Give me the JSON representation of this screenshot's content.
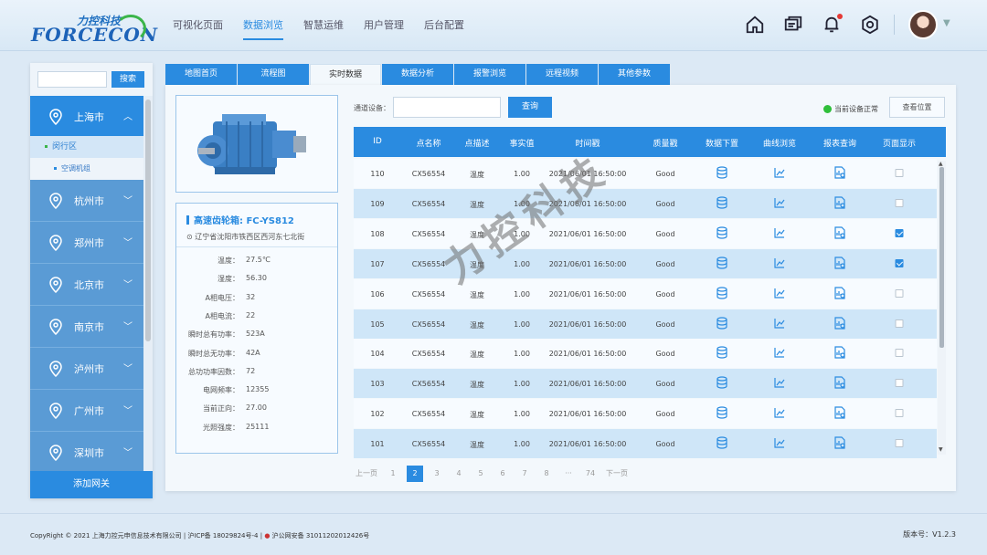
{
  "brand": {
    "cn": "力控科技",
    "en": "FORCECON"
  },
  "nav": [
    "可视化页面",
    "数据浏览",
    "智慧运维",
    "用户管理",
    "后台配置"
  ],
  "nav_active": 1,
  "sidebar": {
    "search_placeholder": "",
    "search_btn": "搜索",
    "cities": [
      "上海市",
      "杭州市",
      "郑州市",
      "北京市",
      "南京市",
      "泸州市",
      "广州市",
      "深圳市"
    ],
    "active_city": "上海市",
    "sub1": "闵行区",
    "sub2": "空调机组",
    "add_gateway": "添加网关"
  },
  "tabs": [
    "地图首页",
    "流程图",
    "实时数据",
    "数据分析",
    "报警浏览",
    "远程视频",
    "其他参数"
  ],
  "tab_active": 2,
  "device": {
    "title": "高速齿轮箱: FC-YS812",
    "address": "辽宁省沈阳市铁西区西河东七北街",
    "props": [
      {
        "k": "温度：",
        "v": "27.5℃"
      },
      {
        "k": "湿度：",
        "v": "56.30"
      },
      {
        "k": "A相电压：",
        "v": "32"
      },
      {
        "k": "A相电流：",
        "v": "22"
      },
      {
        "k": "瞬时总有功率：",
        "v": "523A"
      },
      {
        "k": "瞬时总无功率：",
        "v": "42A"
      },
      {
        "k": "总功功率因数：",
        "v": "72"
      },
      {
        "k": "电网频率：",
        "v": "12355"
      },
      {
        "k": "当前正向：",
        "v": "27.00"
      },
      {
        "k": "光照强度：",
        "v": "25111"
      }
    ]
  },
  "filter": {
    "label": "通道设备：",
    "input_value": "",
    "query_btn": "查询"
  },
  "status": {
    "text": "当前设备正常",
    "color": "#2fbf3a"
  },
  "locate_btn": "查看位置",
  "table": {
    "headers": [
      "ID",
      "点名称",
      "点描述",
      "事实值",
      "时间戳",
      "质量戳",
      "数据下置",
      "曲线浏览",
      "报表查询",
      "页面显示"
    ],
    "rows": [
      {
        "id": "110",
        "name": "CX56554",
        "desc": "温度",
        "val": "1.00",
        "ts": "2021/06/01 16:50:00",
        "q": "Good",
        "show": false
      },
      {
        "id": "109",
        "name": "CX56554",
        "desc": "温度",
        "val": "1.00",
        "ts": "2021/06/01 16:50:00",
        "q": "Good",
        "show": false
      },
      {
        "id": "108",
        "name": "CX56554",
        "desc": "温度",
        "val": "1.00",
        "ts": "2021/06/01 16:50:00",
        "q": "Good",
        "show": true
      },
      {
        "id": "107",
        "name": "CX56554",
        "desc": "温度",
        "val": "1.00",
        "ts": "2021/06/01 16:50:00",
        "q": "Good",
        "show": true
      },
      {
        "id": "106",
        "name": "CX56554",
        "desc": "温度",
        "val": "1.00",
        "ts": "2021/06/01 16:50:00",
        "q": "Good",
        "show": false
      },
      {
        "id": "105",
        "name": "CX56554",
        "desc": "温度",
        "val": "1.00",
        "ts": "2021/06/01 16:50:00",
        "q": "Good",
        "show": false
      },
      {
        "id": "104",
        "name": "CX56554",
        "desc": "温度",
        "val": "1.00",
        "ts": "2021/06/01 16:50:00",
        "q": "Good",
        "show": false
      },
      {
        "id": "103",
        "name": "CX56554",
        "desc": "温度",
        "val": "1.00",
        "ts": "2021/06/01 16:50:00",
        "q": "Good",
        "show": false
      },
      {
        "id": "102",
        "name": "CX56554",
        "desc": "温度",
        "val": "1.00",
        "ts": "2021/06/01 16:50:00",
        "q": "Good",
        "show": false
      },
      {
        "id": "101",
        "name": "CX56554",
        "desc": "温度",
        "val": "1.00",
        "ts": "2021/06/01 16:50:00",
        "q": "Good",
        "show": false
      }
    ],
    "icons": [
      "database-icon",
      "line-chart-icon",
      "report-icon"
    ]
  },
  "pager": [
    "上一页",
    "1",
    "2",
    "3",
    "4",
    "5",
    "6",
    "7",
    "8",
    "···",
    "74",
    "下一页"
  ],
  "pager_active": "2",
  "watermark": "力控科技",
  "footer": {
    "copyright": "CopyRight © 2021 上海力控元申信息技术有限公司 | 沪ICP备 18029824号-4 | ",
    "police": "沪公网安备 31011202012426号",
    "version": "版本号：V1.2.3"
  },
  "colors": {
    "accent": "#2a8be0",
    "sidebar_city": "#5a9bd5",
    "row_alt": "#cfe6f8"
  }
}
